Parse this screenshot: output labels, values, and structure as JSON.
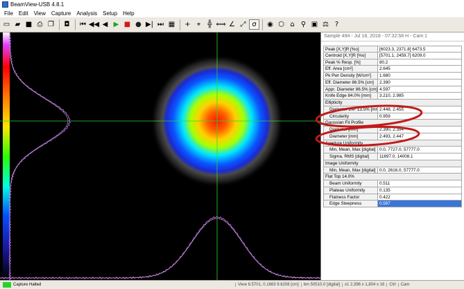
{
  "window": {
    "title": "BeamView-USB 4.8.1"
  },
  "menu": [
    "File",
    "Edit",
    "View",
    "Capture",
    "Analysis",
    "Setup",
    "Help"
  ],
  "toolbar_icons": [
    {
      "name": "new-icon",
      "glyph": "▭"
    },
    {
      "name": "open-icon",
      "glyph": "▰"
    },
    {
      "name": "save-icon",
      "glyph": "■"
    },
    {
      "name": "print-icon",
      "glyph": "⎙"
    },
    {
      "name": "copy-icon",
      "glyph": "❐"
    },
    {
      "name": "camera-icon",
      "glyph": "◘"
    },
    {
      "name": "skip-start-icon",
      "glyph": "⏮"
    },
    {
      "name": "rewind-icon",
      "glyph": "◀◀"
    },
    {
      "name": "step-back-icon",
      "glyph": "◀"
    },
    {
      "name": "play-icon",
      "glyph": "▶"
    },
    {
      "name": "stop-icon",
      "glyph": "■"
    },
    {
      "name": "record-icon",
      "glyph": "●"
    },
    {
      "name": "step-forward-icon",
      "glyph": "▶|"
    },
    {
      "name": "skip-end-icon",
      "glyph": "⏭"
    },
    {
      "name": "clear-icon",
      "glyph": "▦"
    },
    {
      "name": "crosshair-icon",
      "glyph": "+"
    },
    {
      "name": "center-icon",
      "glyph": "⌖"
    },
    {
      "name": "cursor-move-icon",
      "glyph": "╬"
    },
    {
      "name": "cursor-resize-icon",
      "glyph": "⟺"
    },
    {
      "name": "angle-icon",
      "glyph": "∠"
    },
    {
      "name": "fit-icon",
      "glyph": "⤢"
    },
    {
      "name": "sigma-icon",
      "glyph": "σ"
    },
    {
      "name": "settings-icon",
      "glyph": "◉"
    },
    {
      "name": "color-icon",
      "glyph": "⬡"
    },
    {
      "name": "home-icon",
      "glyph": "⌂"
    },
    {
      "name": "zoom-icon",
      "glyph": "⚲"
    },
    {
      "name": "image-icon",
      "glyph": "▣"
    },
    {
      "name": "scale-icon",
      "glyph": "⚖"
    },
    {
      "name": "help-icon",
      "glyph": "?"
    }
  ],
  "panel": {
    "header": "Sample 494 - Jul 18, 2018 - 07:32:58 H - Cam 1"
  },
  "rows": [
    {
      "k": "Peak [X,Y]R [%o]",
      "v": "[6023.3, 2371.8] 6473.5",
      "type": "row"
    },
    {
      "k": "Centroid [X,Y]R [%o]",
      "v": "[5701.1, 2459.7] 6209.0",
      "type": "row"
    },
    {
      "k": "Peak % Resp. [%]",
      "v": "80.2",
      "type": "row"
    },
    {
      "k": "Eff. Area [cm²]",
      "v": "2.645",
      "type": "row"
    },
    {
      "k": "Pk Pwr Density [W/cm²]",
      "v": "1.680",
      "type": "row"
    },
    {
      "k": "Eff. Diameter 86.5% [cm]",
      "v": "2.390",
      "type": "row"
    },
    {
      "k": "Appr. Diameter 86.5% [cm]",
      "v": "4.597",
      "type": "row"
    },
    {
      "k": "Knife Edge 84.0% [mm]",
      "v": "3.210, 2.985",
      "type": "row"
    },
    {
      "k": "Ellipticity",
      "v": "",
      "type": "sec"
    },
    {
      "k": "Diameter 1/e² 13.5% [mm]",
      "v": "2.448, 2.455",
      "type": "ind"
    },
    {
      "k": "Circularity",
      "v": "0.959",
      "type": "ind"
    },
    {
      "k": "Gaussian Fit Profile",
      "v": "",
      "type": "sec"
    },
    {
      "k": "Diameter [mm]",
      "v": "2.390, 2.394",
      "type": "ind"
    },
    {
      "k": "Diameter [mm]",
      "v": "2.493, 2.447",
      "type": "ind"
    },
    {
      "k": "Aperture Uniformity",
      "v": "",
      "type": "sec"
    },
    {
      "k": "Min, Mean, Max [digital]",
      "v": "0.0, 7727.0, 57777.0",
      "type": "ind"
    },
    {
      "k": "Sigma, RMS [digital]",
      "v": "11697.0, 14008.1",
      "type": "ind"
    },
    {
      "k": "Image Uniformity",
      "v": "",
      "type": "sec"
    },
    {
      "k": "Min, Mean, Max [digital]",
      "v": "0.0, 2616.0, 57777.0",
      "type": "ind"
    },
    {
      "k": "Flat Top 14.0%",
      "v": "",
      "type": "sec"
    },
    {
      "k": "Beam Uniformity",
      "v": "0.511",
      "type": "ind"
    },
    {
      "k": "Plateau Uniformity",
      "v": "0.135",
      "type": "ind"
    },
    {
      "k": "Flatness Factor",
      "v": "0.422",
      "type": "ind"
    },
    {
      "k": "Edge Steepness",
      "v": "0.597",
      "type": "ind",
      "hl": true
    }
  ],
  "status": {
    "led": "LIVE",
    "capture": "Capture Halted",
    "viewport": "View 8.5701, 0.1683 9.6208 [cm]",
    "bit": "bm 50510.0 [digital]",
    "xy": "x1 2,396 x 1,804 x 16",
    "ctrl": "Ctrl",
    "cam": "Cam"
  },
  "colors": {
    "cursor": "#2ed92e",
    "profile": "#b36ad6",
    "annotation": "#c21a1a",
    "selected": "#3a76d8"
  }
}
